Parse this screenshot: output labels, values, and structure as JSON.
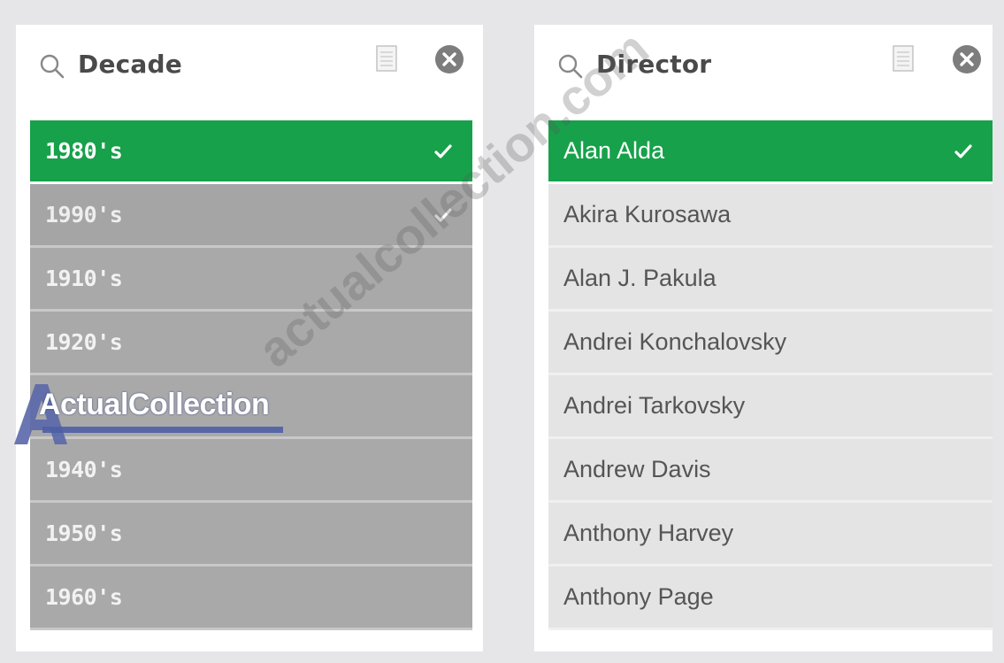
{
  "decade_pane": {
    "title": "Decade",
    "items": [
      {
        "label": "1980's",
        "state": "selected",
        "checked": true
      },
      {
        "label": "1990's",
        "state": "alternative",
        "checked": true
      },
      {
        "label": "1910's",
        "state": "excluded",
        "checked": false
      },
      {
        "label": "1920's",
        "state": "excluded",
        "checked": false
      },
      {
        "label": "",
        "state": "excluded",
        "checked": false
      },
      {
        "label": "1940's",
        "state": "excluded",
        "checked": false
      },
      {
        "label": "1950's",
        "state": "excluded",
        "checked": false
      },
      {
        "label": "1960's",
        "state": "excluded",
        "checked": false
      }
    ]
  },
  "director_pane": {
    "title": "Director",
    "items": [
      {
        "label": "Alan Alda",
        "state": "selected",
        "checked": true
      },
      {
        "label": "Akira Kurosawa",
        "state": "possible",
        "checked": false
      },
      {
        "label": "Alan J. Pakula",
        "state": "possible",
        "checked": false
      },
      {
        "label": "Andrei Konchalovsky",
        "state": "possible",
        "checked": false
      },
      {
        "label": "Andrei Tarkovsky",
        "state": "possible",
        "checked": false
      },
      {
        "label": "Andrew Davis",
        "state": "possible",
        "checked": false
      },
      {
        "label": "Anthony Harvey",
        "state": "possible",
        "checked": false
      },
      {
        "label": "Anthony Page",
        "state": "possible",
        "checked": false
      }
    ]
  },
  "watermark": {
    "diagonal": "actualcollection.com",
    "logo": "ActualCollection"
  },
  "colors": {
    "selected": "#16a14a",
    "alternative": "#a5a5a5",
    "excluded": "#a9a9a9",
    "possible": "#e4e4e4",
    "background": "#e6e6e9"
  }
}
